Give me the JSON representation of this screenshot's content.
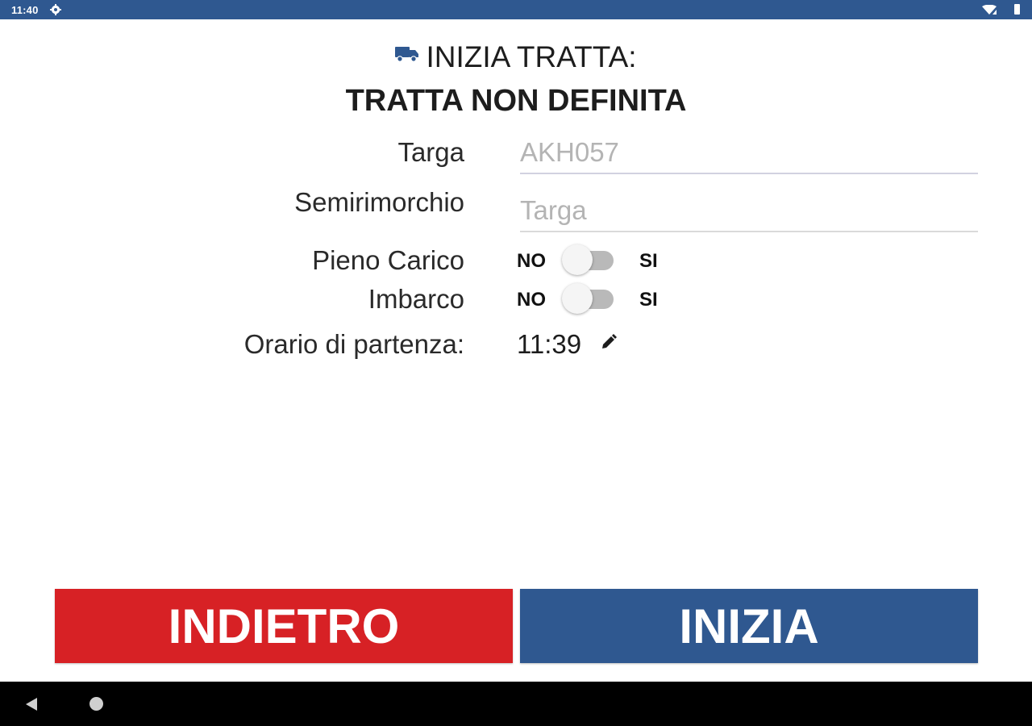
{
  "status_bar": {
    "time": "11:40",
    "icons": [
      "settings-gear-icon",
      "wifi-icon",
      "signal-icon",
      "battery-icon"
    ]
  },
  "header": {
    "icon": "truck-icon",
    "title": "INIZIA TRATTA:",
    "subtitle": "TRATTA NON DEFINITA"
  },
  "form": {
    "targa": {
      "label": "Targa",
      "value": "",
      "placeholder": "AKH057"
    },
    "semirimorchio": {
      "label": "Semirimorchio",
      "value": "",
      "placeholder": "Targa"
    },
    "pieno_carico": {
      "label": "Pieno Carico",
      "off_label": "NO",
      "on_label": "SI",
      "checked": false
    },
    "imbarco": {
      "label": "Imbarco",
      "off_label": "NO",
      "on_label": "SI",
      "checked": false
    },
    "orario": {
      "label": "Orario di partenza:",
      "value": "11:39",
      "edit_icon": "pencil-icon"
    }
  },
  "buttons": {
    "back_label": "INDIETRO",
    "start_label": "INIZIA"
  },
  "nav_bar": {
    "icons": [
      "back-triangle-icon",
      "home-circle-icon"
    ]
  },
  "colors": {
    "primary_blue": "#2f5890",
    "danger_red": "#d72125",
    "nav_black": "#000000"
  }
}
